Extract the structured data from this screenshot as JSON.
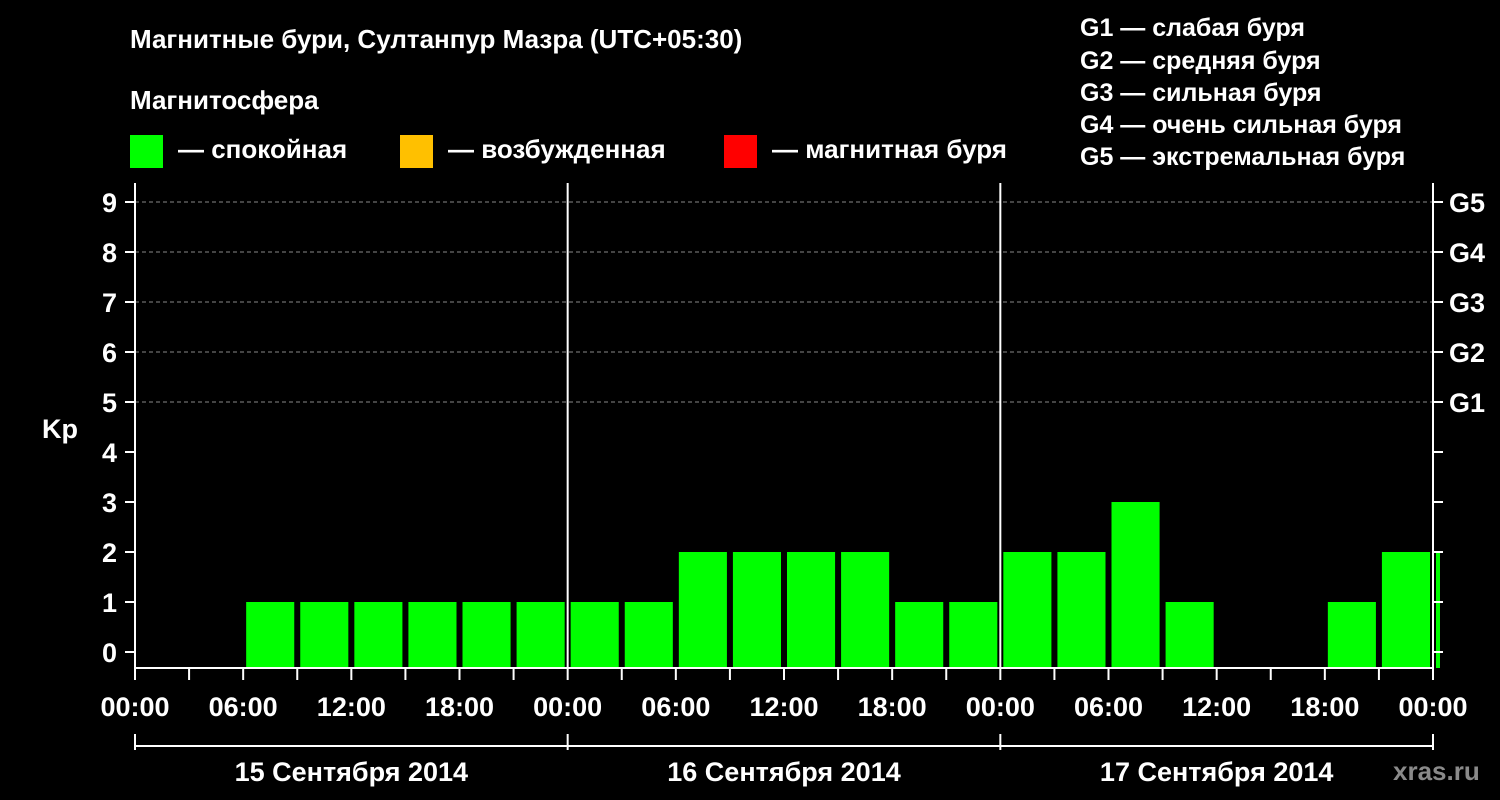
{
  "title": "Магнитные бури, Султанпур Мазра (UTC+05:30)",
  "subtitle": "Магнитосфера",
  "legend": [
    {
      "label": "— спокойная",
      "color": "#00ff00"
    },
    {
      "label": "— возбужденная",
      "color": "#ffc000"
    },
    {
      "label": "— магнитная буря",
      "color": "#ff0000"
    }
  ],
  "g_scale_legend": [
    "G1 — слабая буря",
    "G2 — средняя буря",
    "G3 — сильная буря",
    "G4 — очень сильная буря",
    "G5 — экстремальная буря"
  ],
  "brand": "xras.ru",
  "colors": {
    "background": "#000000",
    "quiet": "#00ff00",
    "grid": "#888888",
    "axis": "#ffffff"
  },
  "chart_data": {
    "type": "bar",
    "ylabel": "Kp",
    "ylim": [
      0,
      9
    ],
    "yticks": [
      "0",
      "1",
      "2",
      "3",
      "4",
      "5",
      "6",
      "7",
      "8",
      "9"
    ],
    "right_axis_labels": [
      {
        "kp": 5,
        "label": "G1"
      },
      {
        "kp": 6,
        "label": "G2"
      },
      {
        "kp": 7,
        "label": "G3"
      },
      {
        "kp": 8,
        "label": "G4"
      },
      {
        "kp": 9,
        "label": "G5"
      }
    ],
    "grid_dashed_levels": [
      5,
      6,
      7,
      8,
      9
    ],
    "x_tick_labels": [
      "00:00",
      "06:00",
      "12:00",
      "18:00",
      "00:00",
      "06:00",
      "12:00",
      "18:00",
      "00:00",
      "06:00",
      "12:00",
      "18:00",
      "00:00"
    ],
    "days": [
      "15 Сентября 2014",
      "16 Сентября 2014",
      "17 Сентября 2014"
    ],
    "interval_hours": 3,
    "values": [
      0,
      0,
      1,
      1,
      1,
      1,
      1,
      1,
      1,
      1,
      2,
      2,
      2,
      2,
      1,
      1,
      2,
      2,
      3,
      1,
      0,
      0,
      1,
      2,
      2
    ],
    "last_bar_partial": true
  }
}
